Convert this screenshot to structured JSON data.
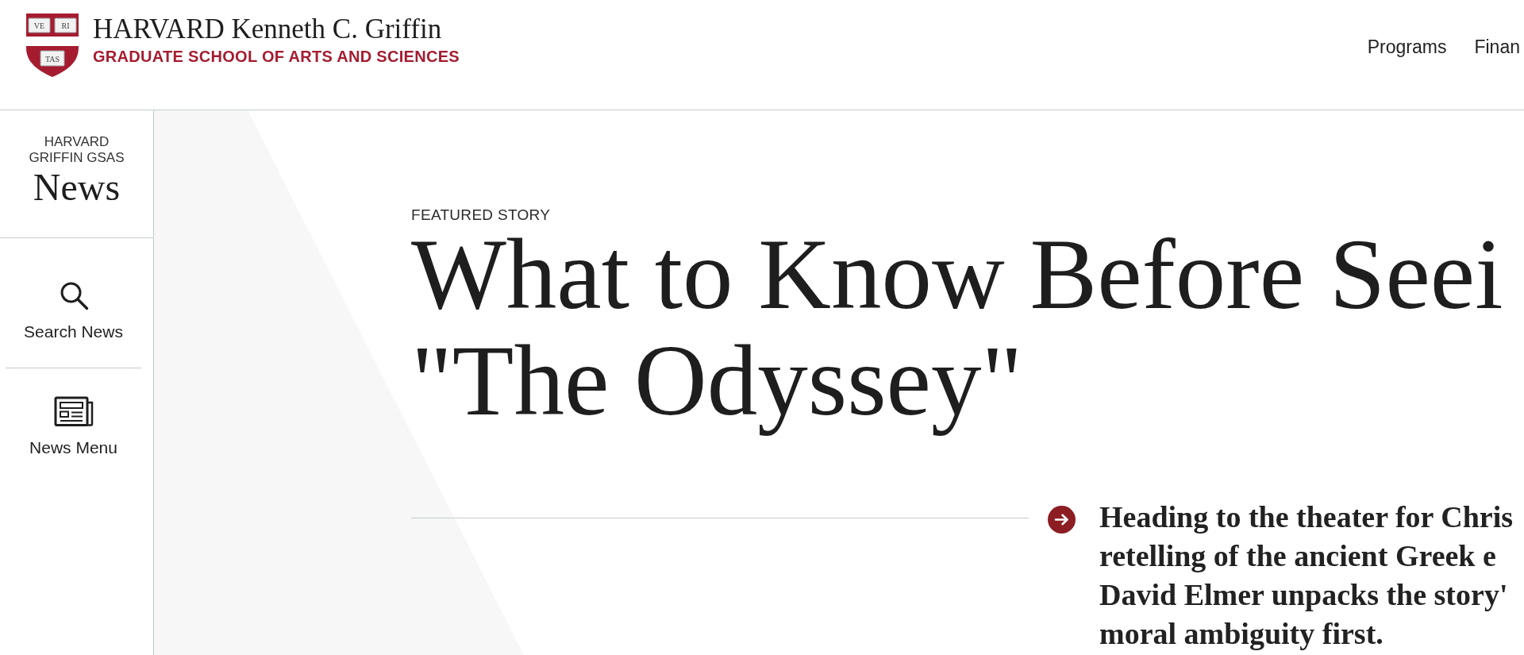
{
  "header": {
    "logo": {
      "motto": [
        "VE",
        "RI",
        "TAS"
      ],
      "wordmark": "HARVARD Kenneth C. Griffin",
      "school": "GRADUATE SCHOOL OF ARTS AND SCIENCES"
    },
    "nav": [
      {
        "label": "Programs"
      },
      {
        "label": "Finan"
      }
    ]
  },
  "sidebar": {
    "brand": {
      "label_lines": [
        "HARVARD",
        "GRIFFIN GSAS"
      ],
      "title": "News"
    },
    "items": [
      {
        "kind": "search",
        "label": "Search News"
      },
      {
        "kind": "menu",
        "label": "News Menu"
      }
    ]
  },
  "featured_story": {
    "label": "FEATURED STORY",
    "title_lines": [
      "What to Know Before Seei",
      "\"The Odyssey\""
    ],
    "summary_lines": [
      "Heading to the theater for Chris",
      "retelling of the ancient Greek e",
      "David Elmer unpacks the story'",
      "moral ambiguity first."
    ]
  }
}
